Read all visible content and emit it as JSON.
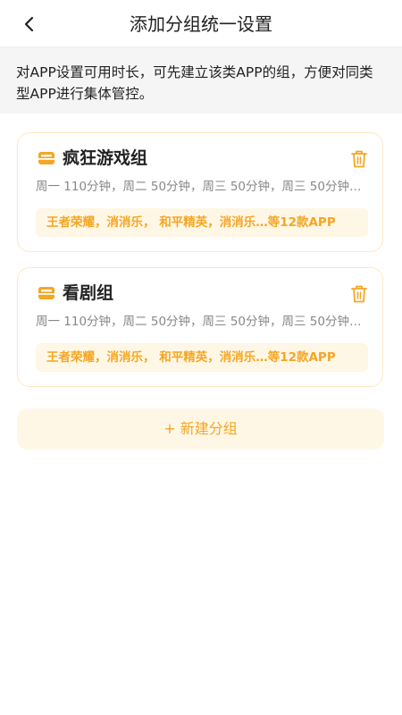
{
  "header": {
    "title": "添加分组统一设置"
  },
  "description": "对APP设置可用时长，可先建立该类APP的组，方便对同类型APP进行集体管控。",
  "groups": [
    {
      "name": "疯狂游戏组",
      "schedule": "周一 110分钟，周二 50分钟，周三 50分钟，周三 50分钟…",
      "apps": "王者荣耀，消消乐， 和平精英，消消乐…等12款APP"
    },
    {
      "name": "看剧组",
      "schedule": "周一 110分钟，周二 50分钟，周三 50分钟，周三 50分钟…",
      "apps": "王者荣耀，消消乐， 和平精英，消消乐…等12款APP"
    }
  ],
  "new_group_label": "+ 新建分组",
  "colors": {
    "accent": "#f5a623",
    "card_border": "#fde9c2",
    "tag_bg": "#fff7e6",
    "desc_bg": "#f5f5f5"
  },
  "icons": {
    "back": "chevron-left-icon",
    "group": "folder-icon",
    "delete": "trash-icon"
  }
}
